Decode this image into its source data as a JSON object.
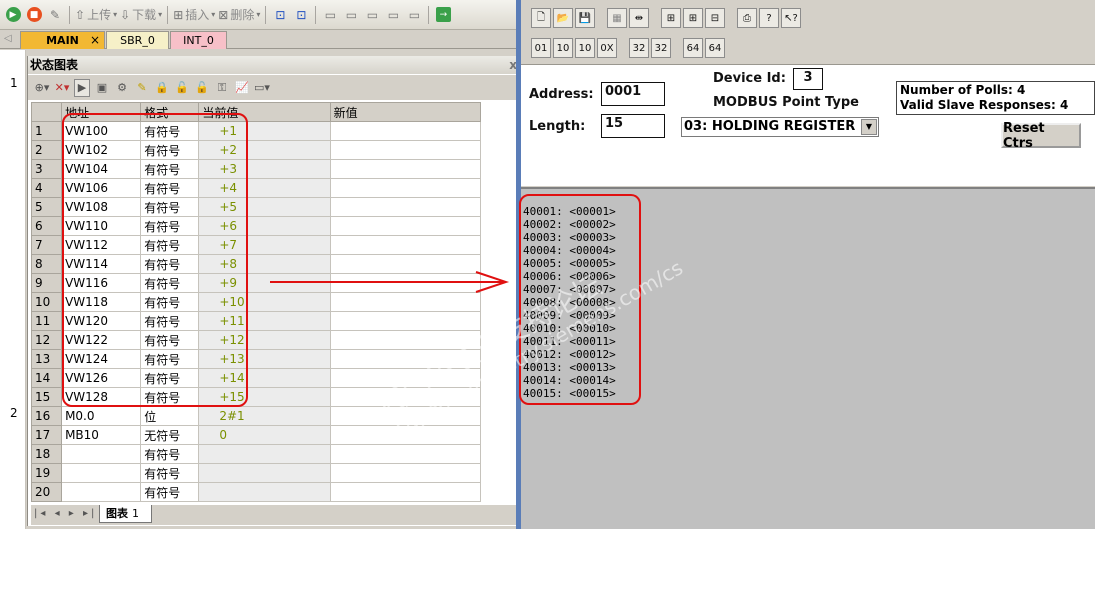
{
  "left_toolbar": {
    "upload_label": "上传",
    "download_label": "下载",
    "insert_label": "插入",
    "delete_label": "删除"
  },
  "program_tabs": [
    {
      "label": "MAIN",
      "active": true
    },
    {
      "label": "SBR_0",
      "active": false
    },
    {
      "label": "INT_0",
      "active": false
    }
  ],
  "ruler": [
    "1",
    "2"
  ],
  "status_chart": {
    "title": "状态图表",
    "close_glyph": "x",
    "columns": [
      "",
      "地址",
      "格式",
      "当前值",
      "新值"
    ],
    "rows": [
      [
        "1",
        "VW100",
        "有符号",
        "+1",
        ""
      ],
      [
        "2",
        "VW102",
        "有符号",
        "+2",
        ""
      ],
      [
        "3",
        "VW104",
        "有符号",
        "+3",
        ""
      ],
      [
        "4",
        "VW106",
        "有符号",
        "+4",
        ""
      ],
      [
        "5",
        "VW108",
        "有符号",
        "+5",
        ""
      ],
      [
        "6",
        "VW110",
        "有符号",
        "+6",
        ""
      ],
      [
        "7",
        "VW112",
        "有符号",
        "+7",
        ""
      ],
      [
        "8",
        "VW114",
        "有符号",
        "+8",
        ""
      ],
      [
        "9",
        "VW116",
        "有符号",
        "+9",
        ""
      ],
      [
        "10",
        "VW118",
        "有符号",
        "+10",
        ""
      ],
      [
        "11",
        "VW120",
        "有符号",
        "+11",
        ""
      ],
      [
        "12",
        "VW122",
        "有符号",
        "+12",
        ""
      ],
      [
        "13",
        "VW124",
        "有符号",
        "+13",
        ""
      ],
      [
        "14",
        "VW126",
        "有符号",
        "+14",
        ""
      ],
      [
        "15",
        "VW128",
        "有符号",
        "+15",
        ""
      ],
      [
        "16",
        "M0.0",
        "位",
        "2#1",
        ""
      ],
      [
        "17",
        "MB10",
        "无符号",
        "0",
        ""
      ],
      [
        "18",
        "",
        "有符号",
        "",
        ""
      ],
      [
        "19",
        "",
        "有符号",
        "",
        ""
      ],
      [
        "20",
        "",
        "有符号",
        "",
        ""
      ]
    ],
    "sheet_nav": "|◂ ◂ ▸ ▸|",
    "sheet_tab_icon": "图表",
    "sheet_tab_label": "1"
  },
  "modbus": {
    "address_label": "Address:",
    "address_value": "0001",
    "length_label": "Length:",
    "length_value": "15",
    "device_id_label": "Device Id:",
    "device_id_value": "3",
    "point_type_label": "MODBUS Point Type",
    "point_type_value": "03: HOLDING REGISTER",
    "polls_text": "Number of Polls: 4",
    "responses_text": "Valid Slave Responses: 4",
    "reset_label": "Reset Ctrs",
    "registers": [
      "40001: <00001>",
      "40002: <00002>",
      "40003: <00003>",
      "40004: <00004>",
      "40005: <00005>",
      "40006: <00006>",
      "40007: <00007>",
      "40008: <00008>",
      "40009: <00009>",
      "40010: <00010>",
      "40011: <00011>",
      "40012: <00012>",
      "40013: <00013>",
      "40014: <00014>",
      "40015: <00015>"
    ],
    "toolbar1": [
      "new-icon",
      "open-icon",
      "save-icon",
      "connect-icon",
      "disconnect-icon",
      "display-icon",
      "display-icon",
      "display-icon",
      "print-icon",
      "help-icon",
      "context-help-icon"
    ],
    "toolbar2": [
      "01",
      "10",
      "10",
      "0X",
      "32",
      "32",
      "64",
      "64"
    ]
  },
  "watermark": {
    "line1": "西门子工业支持论坛",
    "line2": "support.industry.siemens.com/cs"
  },
  "colors": {
    "highlight": "#e01010",
    "value_text": "#7a9000",
    "main_tab": "#f2b833"
  }
}
